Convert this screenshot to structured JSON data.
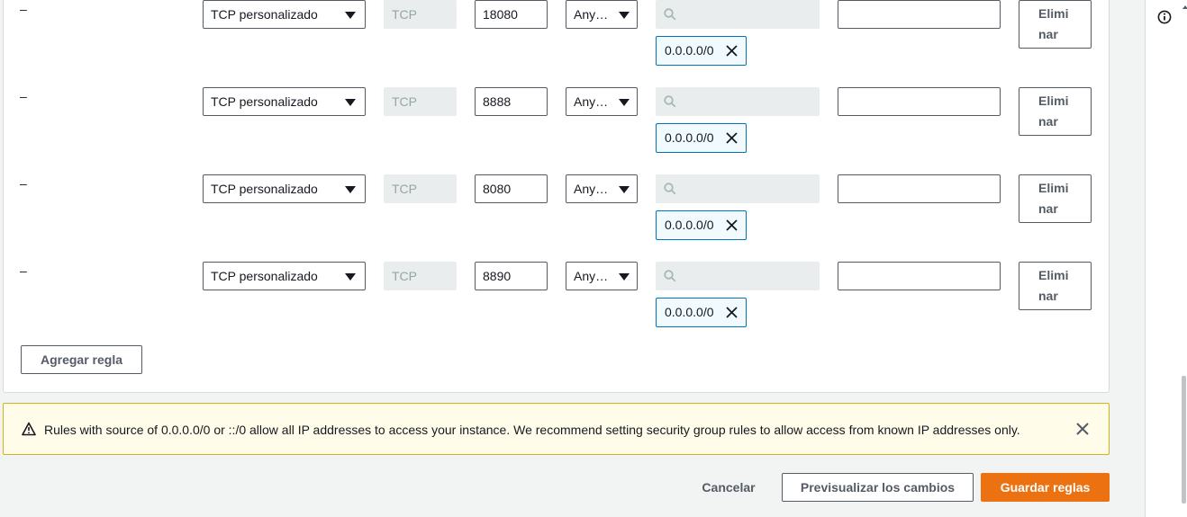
{
  "rules": [
    {
      "dash": "–",
      "type": "TCP personalizado",
      "protocol": "TCP",
      "port": "18080",
      "source": "Any…",
      "cidr": "0.0.0.0/0",
      "delete_label_1": "Elimi",
      "delete_label_2": "nar"
    },
    {
      "dash": "–",
      "type": "TCP personalizado",
      "protocol": "TCP",
      "port": "8888",
      "source": "Any…",
      "cidr": "0.0.0.0/0",
      "delete_label_1": "Elimi",
      "delete_label_2": "nar"
    },
    {
      "dash": "–",
      "type": "TCP personalizado",
      "protocol": "TCP",
      "port": "8080",
      "source": "Any…",
      "cidr": "0.0.0.0/0",
      "delete_label_1": "Elimi",
      "delete_label_2": "nar"
    },
    {
      "dash": "–",
      "type": "TCP personalizado",
      "protocol": "TCP",
      "port": "8890",
      "source": "Any…",
      "cidr": "0.0.0.0/0",
      "delete_label_1": "Elimi",
      "delete_label_2": "nar"
    }
  ],
  "add_rule_label": "Agregar regla",
  "alert": {
    "message": "Rules with source of 0.0.0.0/0 or ::/0 allow all IP addresses to access your instance. We recommend setting security group rules to allow access from known IP addresses only."
  },
  "footer": {
    "cancel_label": "Cancelar",
    "preview_label": "Previsualizar los cambios",
    "save_label": "Guardar reglas"
  },
  "colors": {
    "primary": "#ec7211",
    "token_border": "#0073bb",
    "warning_border": "#d6b31b"
  },
  "icons": {
    "search": "search-icon",
    "token_remove": "close-icon",
    "warning": "warning-icon",
    "info": "info-icon",
    "dropdown": "caret-down-icon"
  }
}
